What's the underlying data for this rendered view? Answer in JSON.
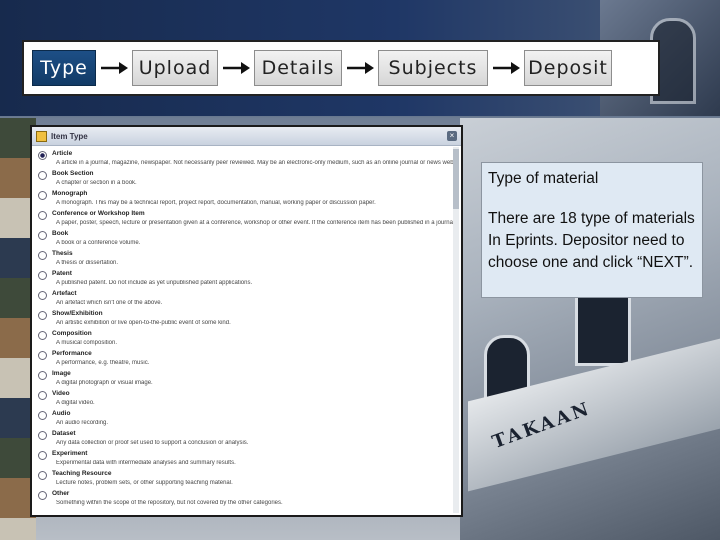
{
  "steps": [
    {
      "label": "Type",
      "active": true
    },
    {
      "label": "Upload",
      "active": false
    },
    {
      "label": "Details",
      "active": false
    },
    {
      "label": "Subjects",
      "active": false
    },
    {
      "label": "Deposit",
      "active": false
    }
  ],
  "panel": {
    "title": "Item Type",
    "items": [
      {
        "name": "Article",
        "desc": "A article in a journal, magazine, newspaper. Not necessarily peer reviewed. May be an electronic-only medium, such as an online journal or news website.",
        "checked": true
      },
      {
        "name": "Book Section",
        "desc": "A chapter or section in a book."
      },
      {
        "name": "Monograph",
        "desc": "A monograph. This may be a technical report, project report, documentation, manual, working paper or discussion paper."
      },
      {
        "name": "Conference or Workshop Item",
        "desc": "A paper, poster, speech, lecture or presentation given at a conference, workshop or other event. If the conference item has been published in a journal or book then please use \"Book Section\" or \"Article\" instead."
      },
      {
        "name": "Book",
        "desc": "A book or a conference volume."
      },
      {
        "name": "Thesis",
        "desc": "A thesis or dissertation."
      },
      {
        "name": "Patent",
        "desc": "A published patent. Do not include as yet unpublished patent applications."
      },
      {
        "name": "Artefact",
        "desc": "An artefact which isn't one of the above."
      },
      {
        "name": "Show/Exhibition",
        "desc": "An artistic exhibition or live open-to-the-public event of some kind."
      },
      {
        "name": "Composition",
        "desc": "A musical composition."
      },
      {
        "name": "Performance",
        "desc": "A performance, e.g. theatre, music."
      },
      {
        "name": "Image",
        "desc": "A digital photograph or visual image."
      },
      {
        "name": "Video",
        "desc": "A digital video."
      },
      {
        "name": "Audio",
        "desc": "An audio recording."
      },
      {
        "name": "Dataset",
        "desc": "Any data collection or proof set used to support a conclusion or analysis."
      },
      {
        "name": "Experiment",
        "desc": "Experimental data with intermediate analyses and summary results."
      },
      {
        "name": "Teaching Resource",
        "desc": "Lecture notes, problem sets, or other supporting teaching material."
      },
      {
        "name": "Other",
        "desc": "Something within the scope of the repository, but not covered by the other categories."
      }
    ]
  },
  "callout": {
    "title": "Type of material",
    "body": "There are 18 type of materials In Eprints. Depositor need to choose one and click “NEXT”."
  },
  "background": {
    "sign_text": "TAKAAN"
  },
  "colors": {
    "active_step_bg": "#1d4f86",
    "callout_bg": "#dfe9f3"
  }
}
